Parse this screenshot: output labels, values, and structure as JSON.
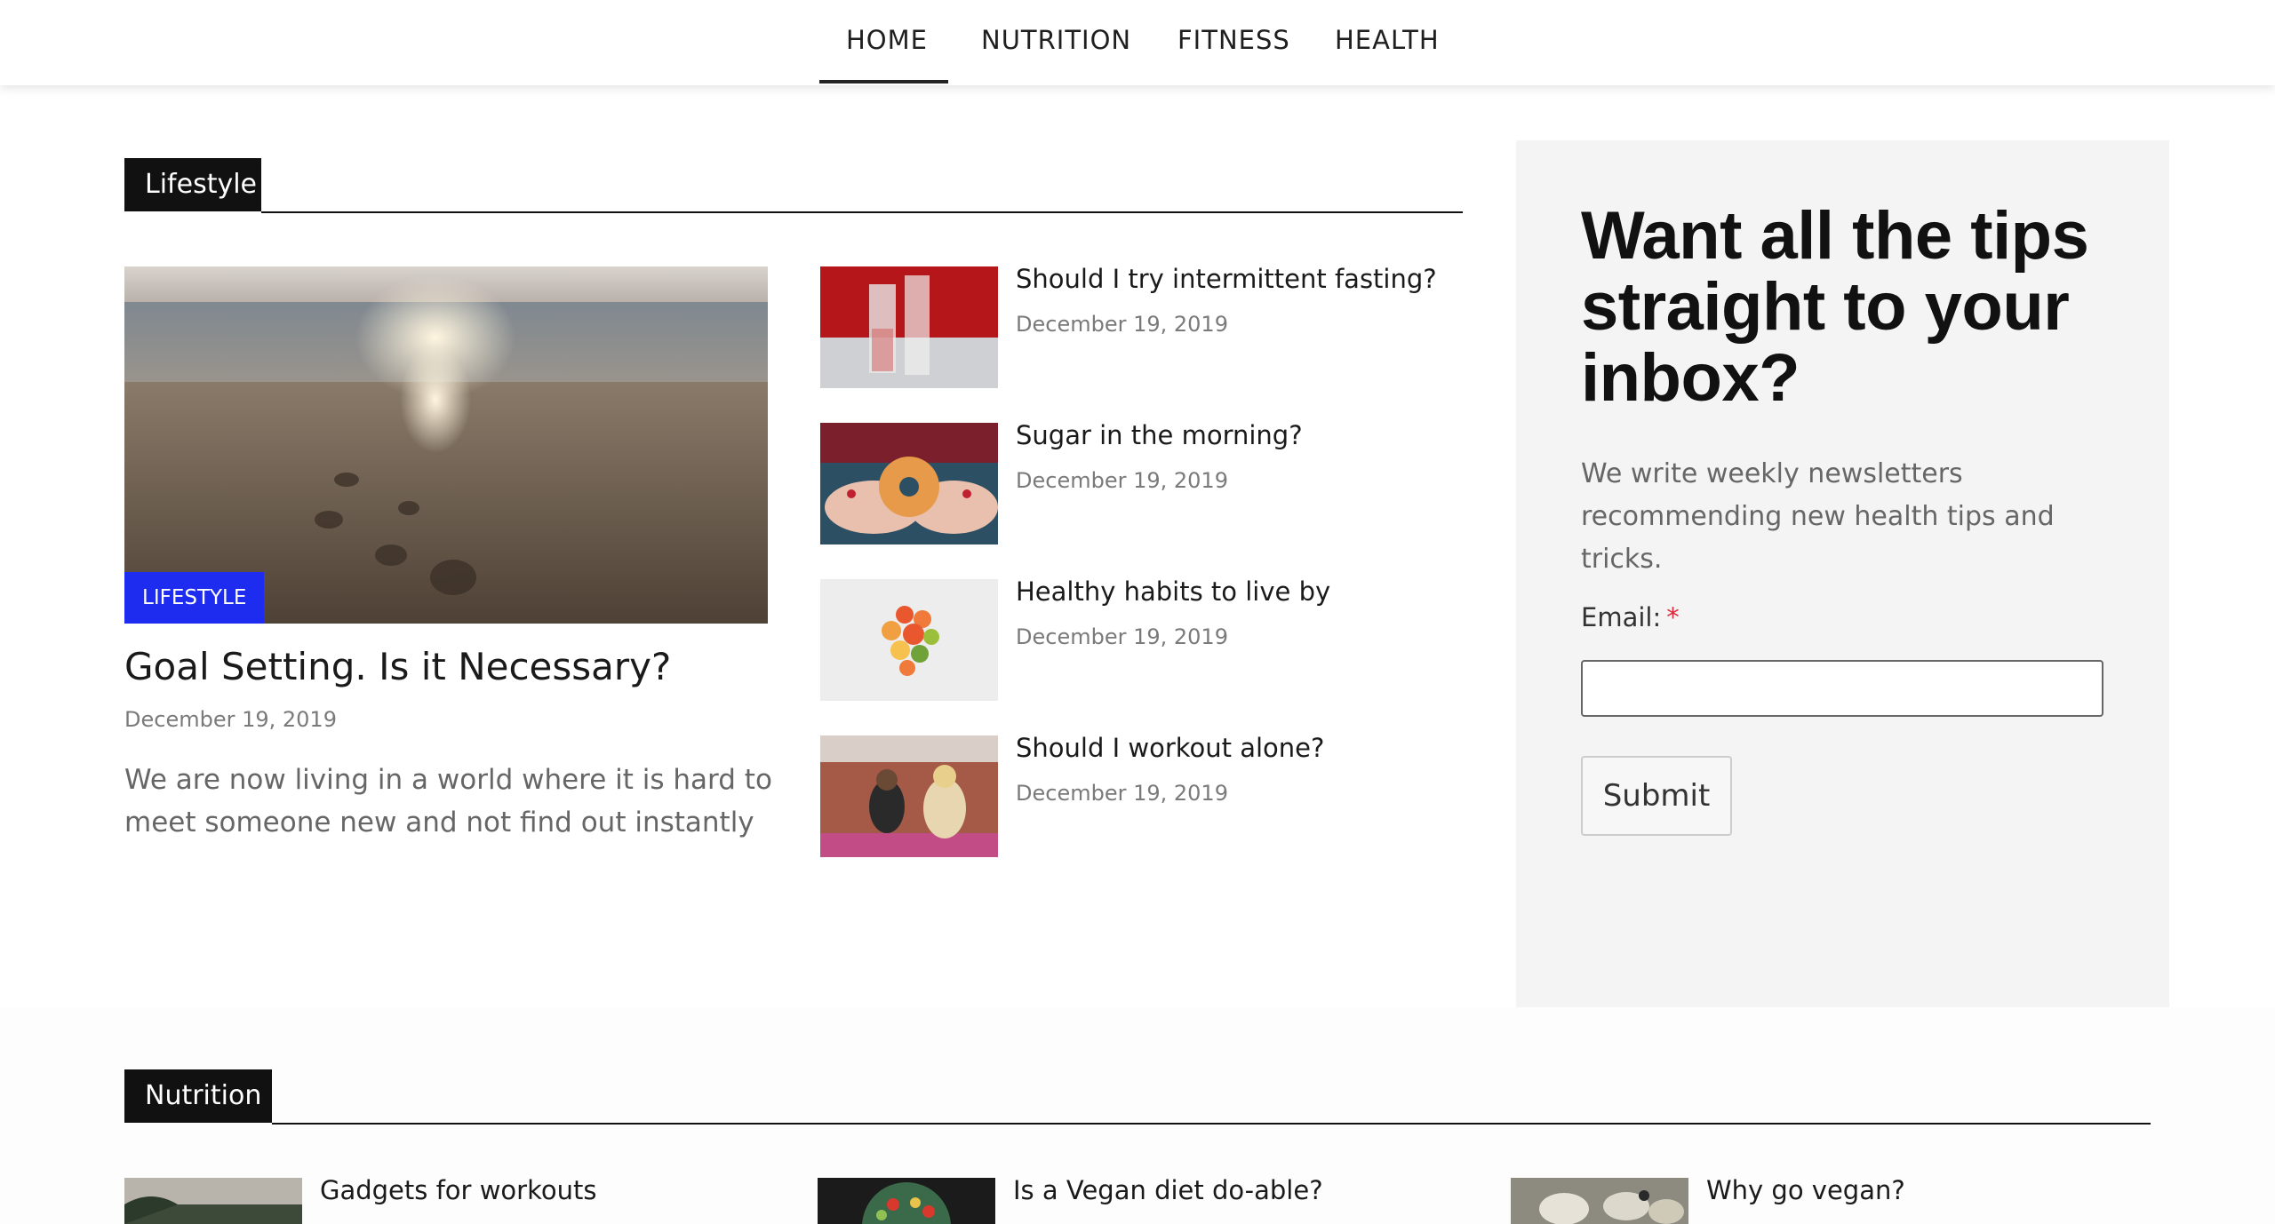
{
  "nav": {
    "items": [
      {
        "label": "HOME",
        "active": true
      },
      {
        "label": "NUTRITION"
      },
      {
        "label": "FITNESS"
      },
      {
        "label": "HEALTH"
      }
    ]
  },
  "lifestyle": {
    "section_label": "Lifestyle",
    "featured": {
      "badge": "LIFESTYLE",
      "title": "Goal Setting. Is it Necessary?",
      "date": "December 19, 2019",
      "excerpt_line1": "We are now living in a world where it is hard to",
      "excerpt_line2": "meet someone new and not find out instantly"
    },
    "posts": [
      {
        "title": "Should I try intermittent fasting?",
        "date": "December 19, 2019"
      },
      {
        "title": "Sugar in the morning?",
        "date": "December 19, 2019"
      },
      {
        "title": "Healthy habits to live by",
        "date": "December 19, 2019"
      },
      {
        "title": "Should I workout alone?",
        "date": "December 19, 2019"
      }
    ]
  },
  "newsletter": {
    "heading_line1": "Want all the tips",
    "heading_line2": "straight to your",
    "heading_line3": "inbox?",
    "desc_line1": "We write weekly newsletters",
    "desc_line2": "recommending new health tips and tricks.",
    "email_label": "Email:",
    "required_mark": "*",
    "email_value": "",
    "submit_label": "Submit"
  },
  "nutrition": {
    "section_label": "Nutrition",
    "posts": [
      {
        "title": "Gadgets for workouts"
      },
      {
        "title": "Is a Vegan diet do-able?"
      },
      {
        "title": "Why go vegan?"
      }
    ]
  },
  "colors": {
    "badge_blue": "#1e2cf0",
    "label_black": "#111111",
    "sidebar_bg": "#f4f4f4",
    "required_red": "#e2263a"
  }
}
